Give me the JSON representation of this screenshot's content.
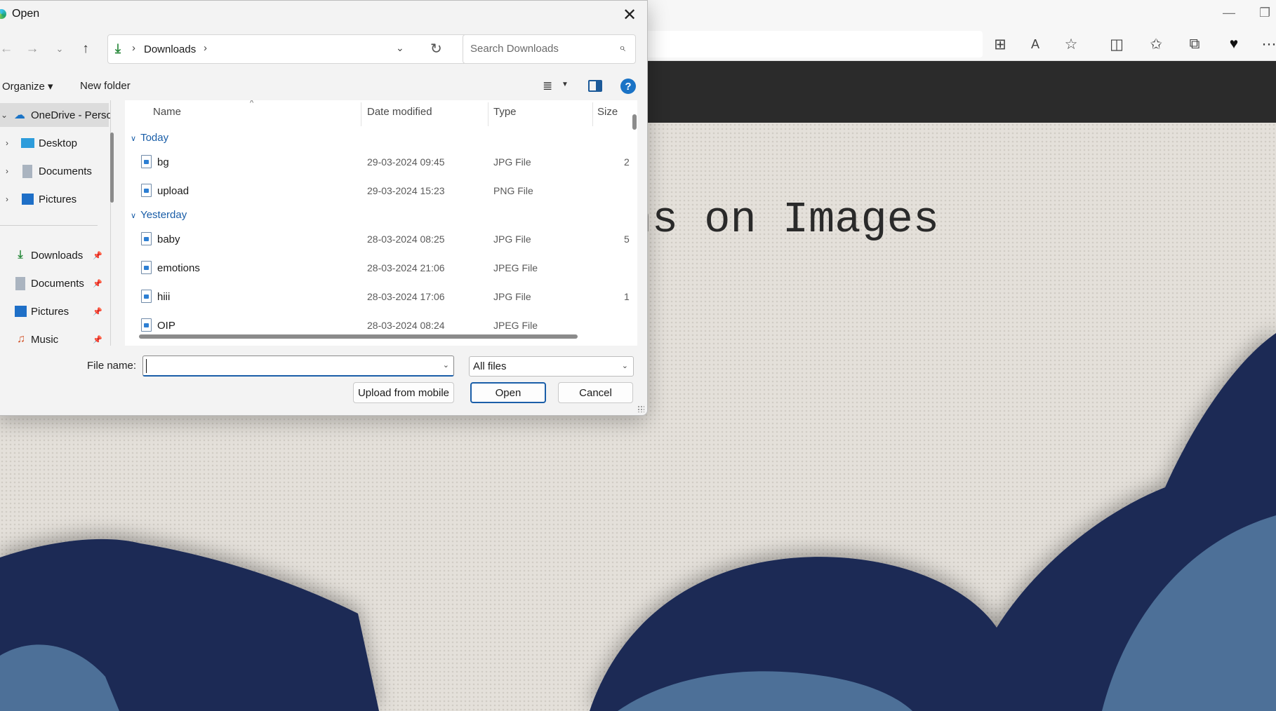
{
  "dialog": {
    "title": "Open",
    "address": {
      "folder": "Downloads",
      "separator": "›"
    },
    "search": {
      "placeholder": "Search Downloads"
    },
    "commands": {
      "organize": "Organize ▾",
      "new_folder": "New folder",
      "help": "?"
    },
    "nav_pane": {
      "items": [
        {
          "label": "OneDrive - Personal",
          "icon": "cloud-icon"
        },
        {
          "label": "Desktop",
          "icon": "desktop-icon"
        },
        {
          "label": "Documents",
          "icon": "documents-icon"
        },
        {
          "label": "Pictures",
          "icon": "pictures-icon"
        },
        {
          "label": "Downloads",
          "icon": "download-icon"
        },
        {
          "label": "Documents",
          "icon": "documents-icon"
        },
        {
          "label": "Pictures",
          "icon": "pictures-icon"
        },
        {
          "label": "Music",
          "icon": "music-icon"
        }
      ]
    },
    "columns": {
      "name": "Name",
      "date": "Date modified",
      "type": "Type",
      "size": "Size"
    },
    "groups": [
      {
        "label": "Today",
        "files": [
          {
            "name": "bg",
            "date": "29-03-2024 09:45",
            "type": "JPG File",
            "size": "2"
          },
          {
            "name": "upload",
            "date": "29-03-2024 15:23",
            "type": "PNG File",
            "size": ""
          }
        ]
      },
      {
        "label": "Yesterday",
        "files": [
          {
            "name": "baby",
            "date": "28-03-2024 08:25",
            "type": "JPG File",
            "size": "5"
          },
          {
            "name": "emotions",
            "date": "28-03-2024 21:06",
            "type": "JPEG File",
            "size": ""
          },
          {
            "name": "hiii",
            "date": "28-03-2024 17:06",
            "type": "JPG File",
            "size": "1"
          },
          {
            "name": "OIP",
            "date": "28-03-2024 08:24",
            "type": "JPEG File",
            "size": ""
          }
        ]
      }
    ],
    "file_name": {
      "label": "File name:",
      "value": ""
    },
    "filter": {
      "selected": "All files"
    },
    "buttons": {
      "upload_mobile": "Upload from mobile",
      "open": "Open",
      "cancel": "Cancel"
    }
  },
  "page": {
    "heading": "sions on Images"
  },
  "colors": {
    "accent": "#1a5ea8",
    "header_bg": "#2b2b2b",
    "wave_dark": "#1c2b55",
    "wave_light": "#4e6f98"
  }
}
